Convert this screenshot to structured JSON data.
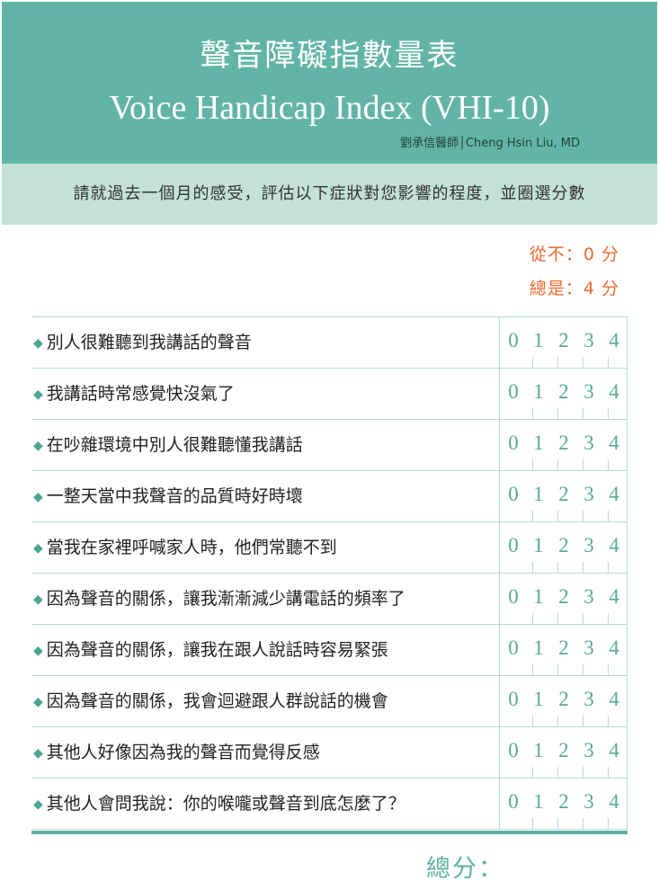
{
  "header": {
    "title_zh": "聲音障礙指數量表",
    "title_en": "Voice Handicap Index (VHI-10)",
    "author": "劉承信醫師│Cheng Hsin Liu, MD"
  },
  "instruction": "請就過去一個月的感受，評估以下症狀對您影響的程度，並圈選分數",
  "legend": {
    "never": "從不：0 分",
    "always": "總是：4 分"
  },
  "bullet_icon": "◆",
  "score_options": [
    "0",
    "1",
    "2",
    "3",
    "4"
  ],
  "questions": [
    "別人很難聽到我講話的聲音",
    "我講話時常感覺快沒氣了",
    "在吵雜環境中別人很難聽懂我講話",
    "一整天當中我聲音的品質時好時壞",
    "當我在家裡呼喊家人時，他們常聽不到",
    "因為聲音的關係，讓我漸漸減少講電話的頻率了",
    "因為聲音的關係，讓我在跟人說話時容易緊張",
    "因為聲音的關係，我會迴避跟人群說話的機會",
    "其他人好像因為我的聲音而覺得反感",
    "其他人會問我說：你的喉嚨或聲音到底怎麼了？"
  ],
  "total_label": "總分：",
  "colors": {
    "header_bg": "#62b5a6",
    "instruction_bg": "#c3e0d9",
    "legend": "#ec6a2f",
    "score": "#58a998"
  }
}
